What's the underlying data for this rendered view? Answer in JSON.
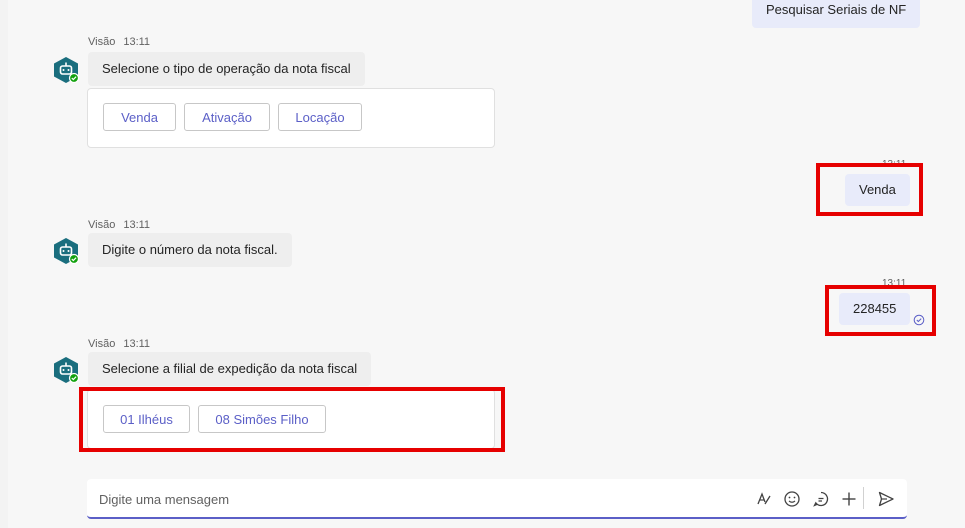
{
  "messages": {
    "top_user_message": "Pesquisar Seriais de NF",
    "bot_block_1": {
      "sender": "Visão",
      "time": "13:11",
      "text": "Selecione o tipo de operação da nota fiscal",
      "options": [
        "Venda",
        "Ativação",
        "Locação"
      ]
    },
    "user_reply_1": {
      "time": "13:11",
      "text": "Venda"
    },
    "bot_block_2": {
      "sender": "Visão",
      "time": "13:11",
      "text": "Digite o número da nota fiscal."
    },
    "user_reply_2": {
      "time": "13:11",
      "text": "228455"
    },
    "bot_block_3": {
      "sender": "Visão",
      "time": "13:11",
      "text": "Selecione a filial de expedição da nota fiscal",
      "options": [
        "01 Ilhéus",
        "08 Simões Filho"
      ]
    }
  },
  "composer": {
    "placeholder": "Digite uma mensagem",
    "icons": [
      "format-icon",
      "emoji-icon",
      "loop-icon",
      "plus-icon",
      "send-icon"
    ]
  },
  "colors": {
    "accent": "#5b5fc7",
    "highlight": "#e60000",
    "user_bubble": "#e8ebfa",
    "bot_bubble": "#eeeeee",
    "status_green": "#13a10e"
  }
}
